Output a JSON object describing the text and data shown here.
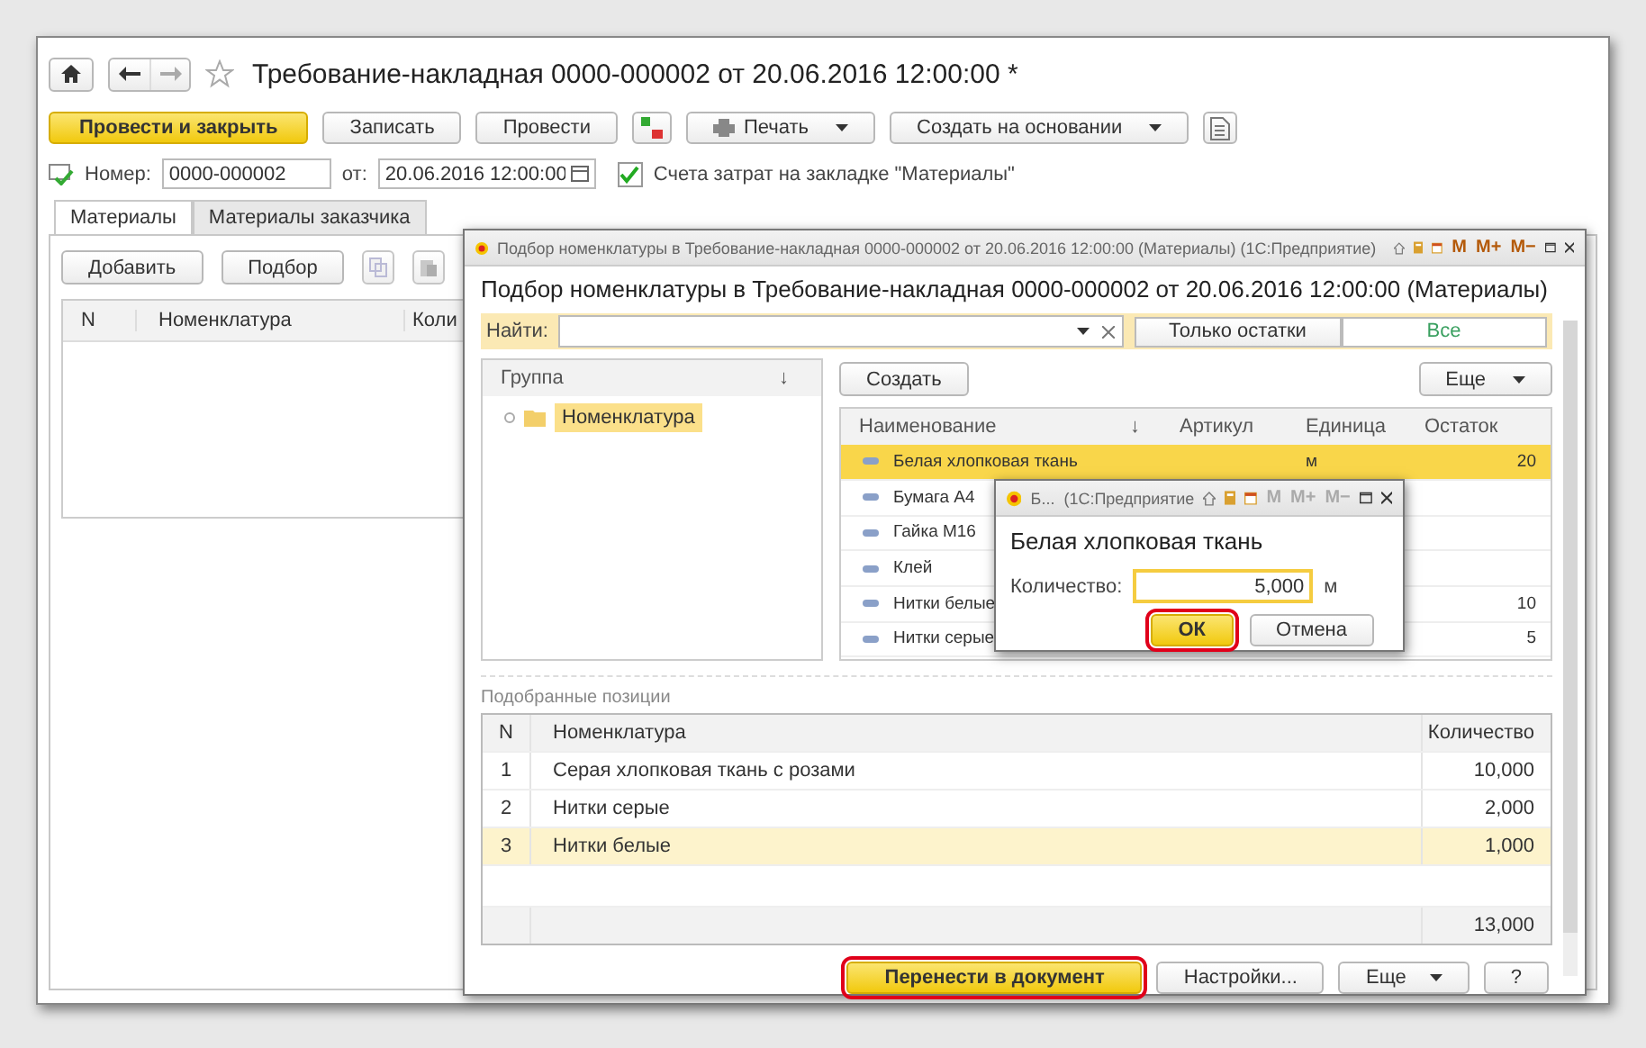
{
  "main_window": {
    "title": "Требование-накладная 0000-000002 от 20.06.2016 12:00:00 *",
    "toolbar": [
      {
        "label": "Провести и закрыть",
        "kind": "primary"
      },
      {
        "label": "Записать",
        "kind": "plain"
      },
      {
        "label": "Провести",
        "kind": "plain"
      },
      {
        "kind": "dtkt-icon"
      },
      {
        "label": "Печать",
        "kind": "dropdown"
      },
      {
        "label": "Создать на основании",
        "kind": "dropdown"
      },
      {
        "kind": "doc-icon"
      }
    ],
    "number_label": "Номер:",
    "number": "0000-000002",
    "date_label": "от:",
    "date": "20.06.2016 12:00:00",
    "cost_accounts": {
      "label": "Счета затрат на закладке \"Материалы\"",
      "checked": true
    },
    "tabs": [
      {
        "label": "Материалы",
        "selected": true
      },
      {
        "label": "Материалы заказчика",
        "selected": false
      }
    ],
    "tab_buttons": [
      "Добавить",
      "Подбор"
    ],
    "table": {
      "columns": [
        "N",
        "Номенклатура",
        "Коли"
      ]
    }
  },
  "picker_dialog": {
    "window_title": "Подбор номенклатуры в Требование-накладная 0000-000002 от 20.06.2016 12:00:00 (Материалы)  (1С:Предприятие)",
    "title_buttons": [
      "M",
      "M+",
      "M−"
    ],
    "heading": "Подбор номенклатуры в Требование-накладная 0000-000002 от 20.06.2016 12:00:00 (Материалы)",
    "search_label": "Найти:",
    "filter": [
      {
        "label": "Только остатки",
        "selected": false
      },
      {
        "label": "Все",
        "selected": true
      }
    ],
    "group_tree": {
      "column": "Группа",
      "sort_mark": "↓",
      "items": [
        {
          "label": "Номенклатура",
          "selected": true
        }
      ]
    },
    "create_button": "Создать",
    "more_button": "Еще",
    "items_table": {
      "columns": [
        "Наименование",
        "Артикул",
        "Единица",
        "Остаток"
      ],
      "sort_mark": "↓",
      "rows": [
        {
          "name": "Белая хлопковая ткань",
          "unit": "м",
          "stock": "20",
          "selected": true
        },
        {
          "name": "Бумага А4",
          "selected": false
        },
        {
          "name": "Гайка М16",
          "selected": false
        },
        {
          "name": "Клей",
          "selected": false
        },
        {
          "name": "Нитки белые",
          "stock": "10",
          "selected": false
        },
        {
          "name": "Нитки серые",
          "stock": "5",
          "selected": false
        }
      ]
    },
    "picked_label": "Подобранные позиции",
    "picked_table": {
      "columns": [
        "N",
        "Номенклатура",
        "Количество"
      ],
      "rows": [
        {
          "n": "1",
          "name": "Серая хлопковая ткань с розами",
          "qty": "10,000",
          "selected": false
        },
        {
          "n": "2",
          "name": "Нитки серые",
          "qty": "2,000",
          "selected": false
        },
        {
          "n": "3",
          "name": "Нитки белые",
          "qty": "1,000",
          "selected": true
        }
      ],
      "total": "13,000"
    },
    "buttons": [
      {
        "label": "Перенести в документ",
        "kind": "primary",
        "highlighted": true
      },
      {
        "label": "Настройки...",
        "kind": "plain",
        "highlighted": false
      },
      {
        "label": "Еще",
        "kind": "dropdown",
        "highlighted": false
      },
      {
        "label": "?",
        "kind": "plain",
        "highlighted": false
      }
    ]
  },
  "quantity_dialog": {
    "window_title": "Б...",
    "app_title": "(1С:Предприятие",
    "title_buttons": [
      "M",
      "M+",
      "M−"
    ],
    "heading": "Белая хлопковая ткань",
    "quantity_label": "Количество:",
    "quantity": "5,000",
    "unit": "м",
    "buttons": [
      {
        "label": "ОК",
        "kind": "primary",
        "highlighted": true
      },
      {
        "label": "Отмена",
        "kind": "plain",
        "highlighted": false
      }
    ]
  }
}
